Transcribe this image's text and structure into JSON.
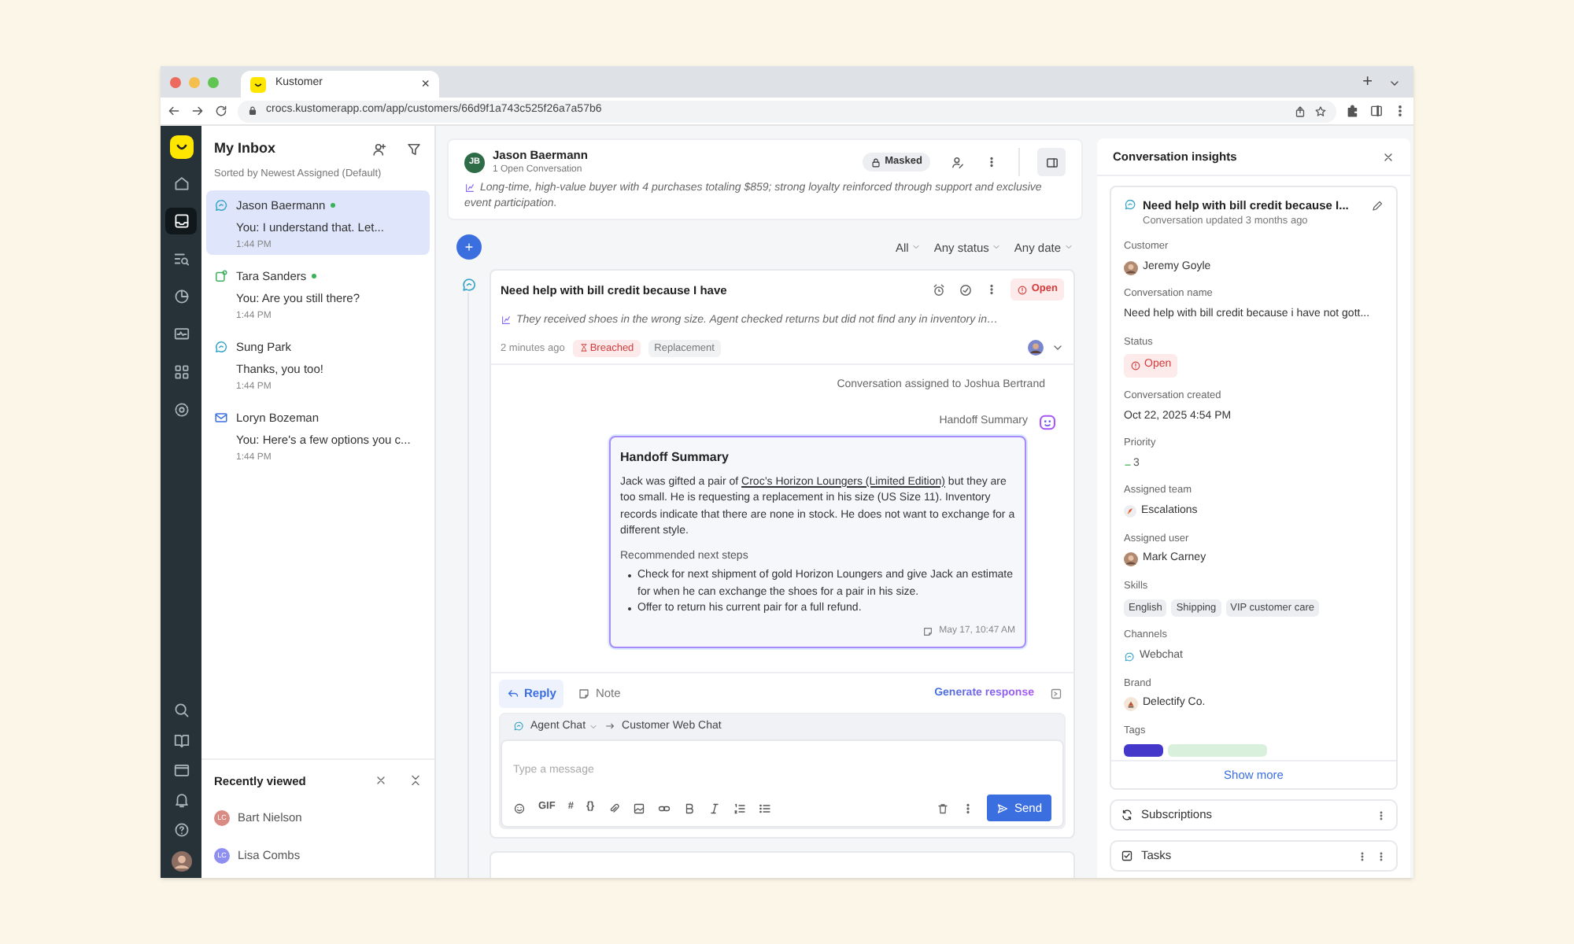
{
  "browser": {
    "tab_title": "Kustomer",
    "tab_close": "×",
    "new_tab": "+",
    "url": "crocs.kustomerapp.com/app/customers/66d9f1a743c525f26a7a57b6"
  },
  "nav_top": [
    {
      "kind": "home",
      "selected": false
    },
    {
      "kind": "inbox",
      "selected": true
    },
    {
      "kind": "queue",
      "selected": false
    },
    {
      "kind": "reports",
      "selected": false
    },
    {
      "kind": "monitor",
      "selected": false
    },
    {
      "kind": "apps",
      "selected": false
    },
    {
      "kind": "settings",
      "selected": false
    }
  ],
  "nav_bottom": [
    {
      "kind": "search"
    },
    {
      "kind": "book"
    },
    {
      "kind": "folder"
    },
    {
      "kind": "bell"
    },
    {
      "kind": "help"
    }
  ],
  "inbox": {
    "title": "My Inbox",
    "sort": "Sorted by Newest Assigned (Default)",
    "conversations": [
      {
        "name": "Jason Baermann",
        "preview": "You: I understand that. Let...",
        "time": "1:44 PM",
        "kind": "chat",
        "online": true,
        "selected": true
      },
      {
        "name": "Tara Sanders",
        "preview": "You: Are you still there?",
        "time": "1:44 PM",
        "kind": "sms",
        "online": true,
        "selected": false
      },
      {
        "name": "Sung Park",
        "preview": "Thanks, you too!",
        "time": "1:44 PM",
        "kind": "chat",
        "online": false,
        "selected": false
      },
      {
        "name": "Loryn Bozeman",
        "preview": "You: Here's a few options you c...",
        "time": "1:44 PM",
        "kind": "email",
        "online": false,
        "selected": false
      }
    ]
  },
  "recently_viewed": {
    "title": "Recently viewed",
    "items": [
      {
        "initials": "LC",
        "name": "Bart Nielson",
        "color": "#d98a82"
      },
      {
        "initials": "LC",
        "name": "Lisa Combs",
        "color": "#8f8ff2"
      }
    ]
  },
  "customer": {
    "initials": "JB",
    "name": "Jason Baermann",
    "subtitle": "1 Open Conversation",
    "badge": "Masked",
    "summary": "Long-time, high-value buyer with 4 purchases totaling $859; strong loyalty reinforced through support and exclusive event participation."
  },
  "filters": [
    "All",
    "Any status",
    "Any date"
  ],
  "conversation": {
    "title": "Need help with bill credit because I have",
    "status": "Open",
    "summary": "They received shoes in the wrong size. Agent checked returns but did not find any in inventory in…",
    "time": "2 minutes ago",
    "tags": [
      {
        "label": "Breached",
        "kind": "breached"
      },
      {
        "label": "Replacement",
        "kind": "plain"
      }
    ],
    "event": "Conversation assigned to Joshua Bertrand",
    "handoff_label": "Handoff Summary",
    "handoff": {
      "title": "Handoff Summary",
      "body_before": "Jack was gifted a pair of",
      "link": "Croc’s Horizon Loungers (Limited Edition)",
      "body_after": "but they are too small. He is requesting a replacement in his size (US Size 11). Inventory records indicate that there are none in stock. He does not want to exchange for a different style.",
      "steps_title": "Recommended next steps",
      "steps": [
        "Check for next shipment of gold Horizon Loungers and give Jack an estimate for when he can exchange the shoes for a pair in his size.",
        "Offer to return his current pair for a full refund."
      ],
      "timestamp": "May 17, 10:47 AM"
    }
  },
  "composer": {
    "tabs": [
      {
        "label": "Reply",
        "kind": "reply",
        "selected": true
      },
      {
        "label": "Note",
        "kind": "note",
        "selected": false
      }
    ],
    "generate": "Generate response",
    "from": "Agent Chat",
    "to": "Customer Web Chat",
    "placeholder": "Type a message",
    "send": "Send",
    "tools": [
      {
        "kind": "emoji"
      },
      {
        "kind": "text",
        "label": "GIF"
      },
      {
        "kind": "text",
        "label": "#"
      },
      {
        "kind": "text",
        "label": "{}"
      },
      {
        "kind": "attach"
      },
      {
        "kind": "image"
      },
      {
        "kind": "link"
      },
      {
        "kind": "bold"
      },
      {
        "kind": "italic"
      },
      {
        "kind": "numbered"
      },
      {
        "kind": "bullets"
      }
    ]
  },
  "insights": {
    "title": "Conversation insights",
    "conversation_title": "Need help with bill credit because I...",
    "updated": "Conversation updated 3 months ago",
    "fields": [
      {
        "label": "Customer",
        "kind": "person",
        "value": "Jeremy Goyle"
      },
      {
        "label": "Conversation name",
        "kind": "text",
        "value": "Need help with bill credit because i have not gott..."
      },
      {
        "label": "Status",
        "kind": "status",
        "value": "Open"
      },
      {
        "label": "Conversation created",
        "kind": "text",
        "value": "Oct 22, 2025 4:54 PM"
      },
      {
        "label": "Priority",
        "kind": "priority",
        "value": "3"
      },
      {
        "label": "Assigned team",
        "kind": "team",
        "value": "Escalations"
      },
      {
        "label": "Assigned user",
        "kind": "person",
        "value": "Mark Carney"
      },
      {
        "label": "Skills",
        "kind": "chips",
        "values": [
          "English",
          "Shipping",
          "VIP customer care"
        ]
      },
      {
        "label": "Channels",
        "kind": "channel",
        "value": "Webchat"
      },
      {
        "label": "Brand",
        "kind": "brand",
        "value": "Delectify Co."
      },
      {
        "label": "Tags",
        "kind": "tags",
        "tags": [
          {
            "color": "#4338ca"
          },
          {
            "color": "#d9f0dd"
          }
        ]
      }
    ],
    "show_more": "Show more",
    "sections": [
      {
        "label": "Subscriptions",
        "kind": "subscriptions"
      },
      {
        "label": "Tasks",
        "kind": "tasks"
      }
    ]
  }
}
